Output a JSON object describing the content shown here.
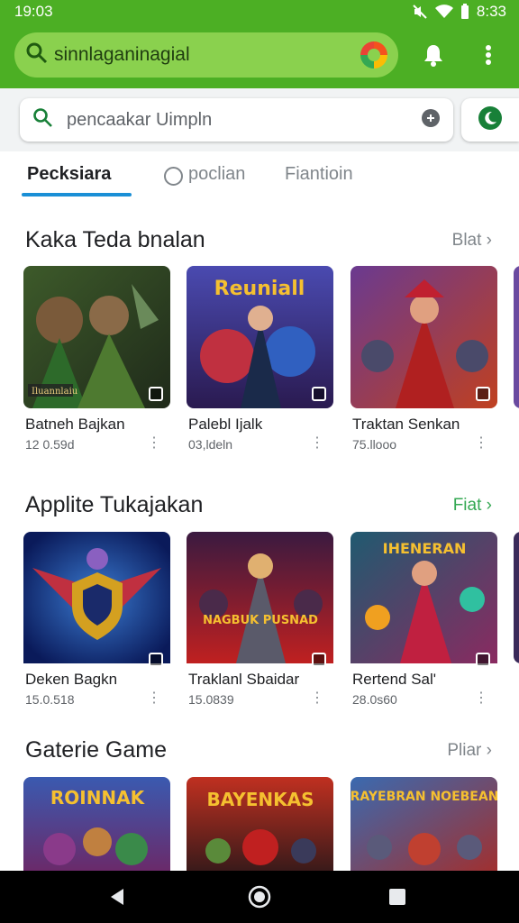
{
  "status": {
    "time_left": "19:03",
    "time_right": "8:33"
  },
  "app_bar": {
    "search_text": "sinnlaganinagial"
  },
  "search": {
    "placeholder": "pencaakar Uimpln"
  },
  "tabs": [
    {
      "label": "Pecksiara",
      "active": true
    },
    {
      "label": "poclian",
      "active": false
    },
    {
      "label": "Fiantioin",
      "active": false
    }
  ],
  "sections": [
    {
      "title": "Kaka Teda bnalan",
      "more": "Blat",
      "more_color": "#80868b",
      "cards": [
        {
          "name": "Batneh Bajkan",
          "meta": "12 0.59d",
          "art_label": "Iluannlaiu",
          "icon": "hero-art-icon"
        },
        {
          "name": "Palebl Ijalk",
          "meta": "03,ldeln",
          "art_label": "Reuniall",
          "icon": "hero-art-icon"
        },
        {
          "name": "Traktan Senkan",
          "meta": "75.llooo",
          "art_label": "",
          "icon": "hero-art-icon"
        }
      ]
    },
    {
      "title": "Applite Tukajakan",
      "more": "Fiat",
      "more_color": "#34a853",
      "cards": [
        {
          "name": "Deken Bagkn",
          "meta": "15.0.518",
          "art_label": "",
          "icon": "shield-art-icon"
        },
        {
          "name": "Traklanl Sbaidar",
          "meta": "15.0839",
          "art_label": "NAGBUK PUSNAD",
          "icon": "hero-art-icon"
        },
        {
          "name": "Rertend Sal'",
          "meta": "28.0s60",
          "art_label": "IHENERAN",
          "icon": "hero-art-icon"
        }
      ]
    },
    {
      "title": "Gaterie Game",
      "more": "Pliar",
      "more_color": "#80868b",
      "cards": [
        {
          "name": "",
          "meta": "",
          "art_label": "ROINNAK",
          "icon": "hero-art-icon"
        },
        {
          "name": "",
          "meta": "",
          "art_label": "BAYENKAS",
          "icon": "hero-art-icon"
        },
        {
          "name": "",
          "meta": "",
          "art_label": "RAYEBRAN NOEBEAN",
          "icon": "hero-art-icon"
        }
      ]
    }
  ],
  "colors": {
    "accent_green": "#4caf24",
    "tab_underline": "#1a8fd6"
  }
}
